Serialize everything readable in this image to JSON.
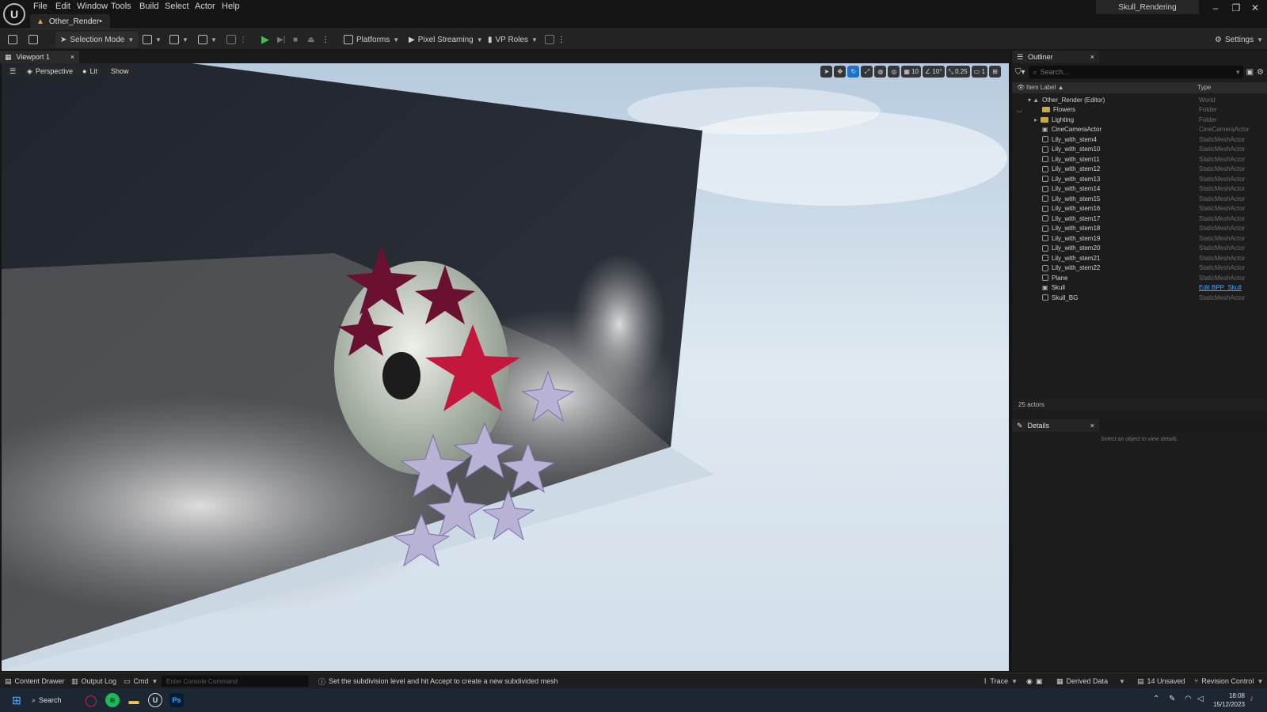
{
  "window": {
    "logo": "U",
    "project_name": "Skull_Rendering",
    "minimize": "–",
    "maximize": "❐",
    "close": "✕"
  },
  "menu": [
    "File",
    "Edit",
    "Window",
    "Tools",
    "Build",
    "Select",
    "Actor",
    "Help"
  ],
  "level_tab": "Other_Render•",
  "toolbar": {
    "selection_mode": "Selection Mode",
    "platforms": "Platforms",
    "pixel_streaming": "Pixel Streaming",
    "vp_roles": "VP Roles",
    "settings": "Settings"
  },
  "viewport": {
    "tab_label": "Viewport 1",
    "tab_close": "×",
    "perspective": "Perspective",
    "lit": "Lit",
    "show": "Show",
    "grid_snap": "10",
    "angle_snap": "10°",
    "scale_snap": "0.25",
    "camera_speed": "1"
  },
  "outliner": {
    "tab_label": "Outliner",
    "tab_close": "×",
    "search_placeholder": "Search...",
    "col_label": "Item Label ▲",
    "col_type": "Type",
    "rows": [
      {
        "label": "Other_Render (Editor)",
        "type": "World"
      },
      {
        "label": "Flowers",
        "type": "Folder"
      },
      {
        "label": "Lighting",
        "type": "Folder"
      },
      {
        "label": "CineCameraActor",
        "type": "CineCameraActor"
      },
      {
        "label": "Lily_with_stem4",
        "type": "StaticMeshActor"
      },
      {
        "label": "Lily_with_stem10",
        "type": "StaticMeshActor"
      },
      {
        "label": "Lily_with_stem11",
        "type": "StaticMeshActor"
      },
      {
        "label": "Lily_with_stem12",
        "type": "StaticMeshActor"
      },
      {
        "label": "Lily_with_stem13",
        "type": "StaticMeshActor"
      },
      {
        "label": "Lily_with_stem14",
        "type": "StaticMeshActor"
      },
      {
        "label": "Lily_with_stem15",
        "type": "StaticMeshActor"
      },
      {
        "label": "Lily_with_stem16",
        "type": "StaticMeshActor"
      },
      {
        "label": "Lily_with_stem17",
        "type": "StaticMeshActor"
      },
      {
        "label": "Lily_with_stem18",
        "type": "StaticMeshActor"
      },
      {
        "label": "Lily_with_stem19",
        "type": "StaticMeshActor"
      },
      {
        "label": "Lily_with_stem20",
        "type": "StaticMeshActor"
      },
      {
        "label": "Lily_with_stem21",
        "type": "StaticMeshActor"
      },
      {
        "label": "Lily_with_stem22",
        "type": "StaticMeshActor"
      },
      {
        "label": "Plane",
        "type": "StaticMeshActor"
      },
      {
        "label": "Skull",
        "type": "Edit BPP_Skull"
      },
      {
        "label": "Skull_BG",
        "type": "StaticMeshActor"
      }
    ],
    "actor_count": "25 actors"
  },
  "details": {
    "tab_label": "Details",
    "tab_close": "×",
    "empty_message": "Select an object to view details."
  },
  "statusbar": {
    "content_drawer": "Content Drawer",
    "output_log": "Output Log",
    "cmd": "Cmd",
    "console_placeholder": "Enter Console Command",
    "message": "Set the subdivision level and hit Accept to create a new subdivided mesh",
    "trace": "Trace",
    "derived_data": "Derived Data",
    "unsaved": "14 Unsaved",
    "revision_control": "Revision Control"
  },
  "taskbar": {
    "search": "Search",
    "photoshop": "Ps",
    "unreal": "U",
    "time": "18:08",
    "date": "15/12/2023"
  },
  "colors": {
    "accent": "#1c72c9",
    "play_green": "#44c04a",
    "link": "#4aa3ff",
    "folder": "#c9a84a"
  }
}
